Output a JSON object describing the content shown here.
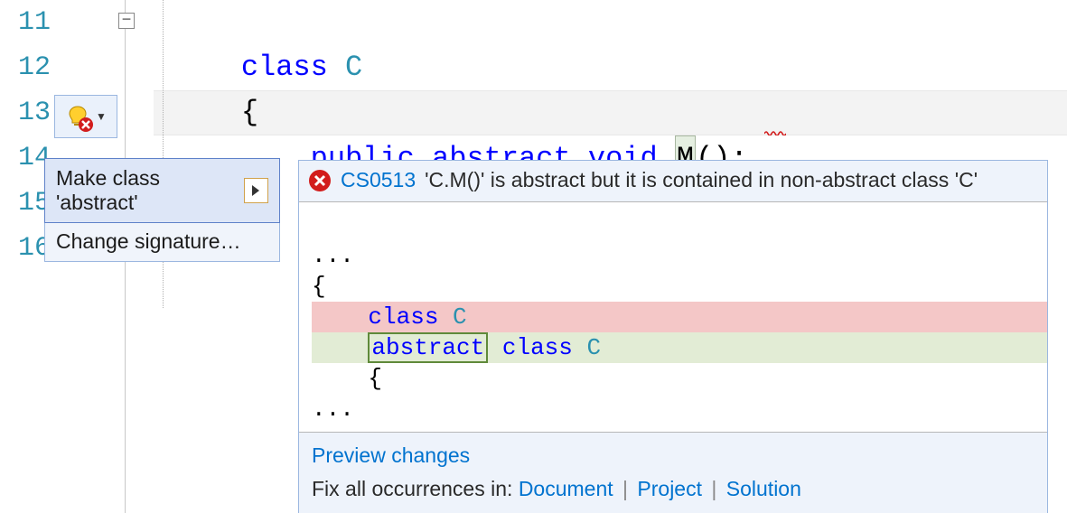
{
  "gutter": {
    "l11": "11",
    "l12": "12",
    "l13": "13",
    "l14": "14",
    "l15": "15",
    "l16": "16"
  },
  "fold": {
    "symbol": "−"
  },
  "code": {
    "line11_kw": "class",
    "line11_sp": " ",
    "line11_ty": "C",
    "line12": "{",
    "line13_indent": "    ",
    "line13_kw1": "public",
    "line13_sp1": " ",
    "line13_kw2": "abstract",
    "line13_sp2": " ",
    "line13_kw3": "void",
    "line13_sp3": " ",
    "line13_m": "M",
    "line13_tail": "();"
  },
  "menu": {
    "item1": "Make class 'abstract'",
    "item2": "Change signature…"
  },
  "preview": {
    "code": "CS0513",
    "msg": "'C.M()' is abstract but it is contained in non-abstract class 'C'"
  },
  "diff": {
    "ell1": "...",
    "brace_open": "{",
    "removed_indent": "    ",
    "removed_kw": "class",
    "removed_sp": " ",
    "removed_ty": "C",
    "added_indent": "    ",
    "added_new": "abstract",
    "added_sp": " ",
    "added_kw": "class",
    "added_sp2": " ",
    "added_ty": "C",
    "brace_open2": "    {",
    "ell2": "..."
  },
  "footer": {
    "preview": "Preview changes",
    "fix_label": "Fix all occurrences in:",
    "doc": "Document",
    "proj": "Project",
    "sol": "Solution",
    "sep": "|"
  }
}
